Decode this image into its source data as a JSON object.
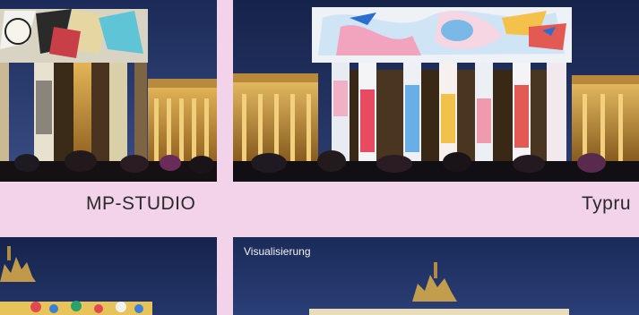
{
  "gallery": {
    "items": [
      {
        "caption": "MP-STUDIO"
      },
      {
        "caption": "Typru"
      },
      {
        "tag": ""
      },
      {
        "tag": "Visualisierung"
      }
    ]
  }
}
